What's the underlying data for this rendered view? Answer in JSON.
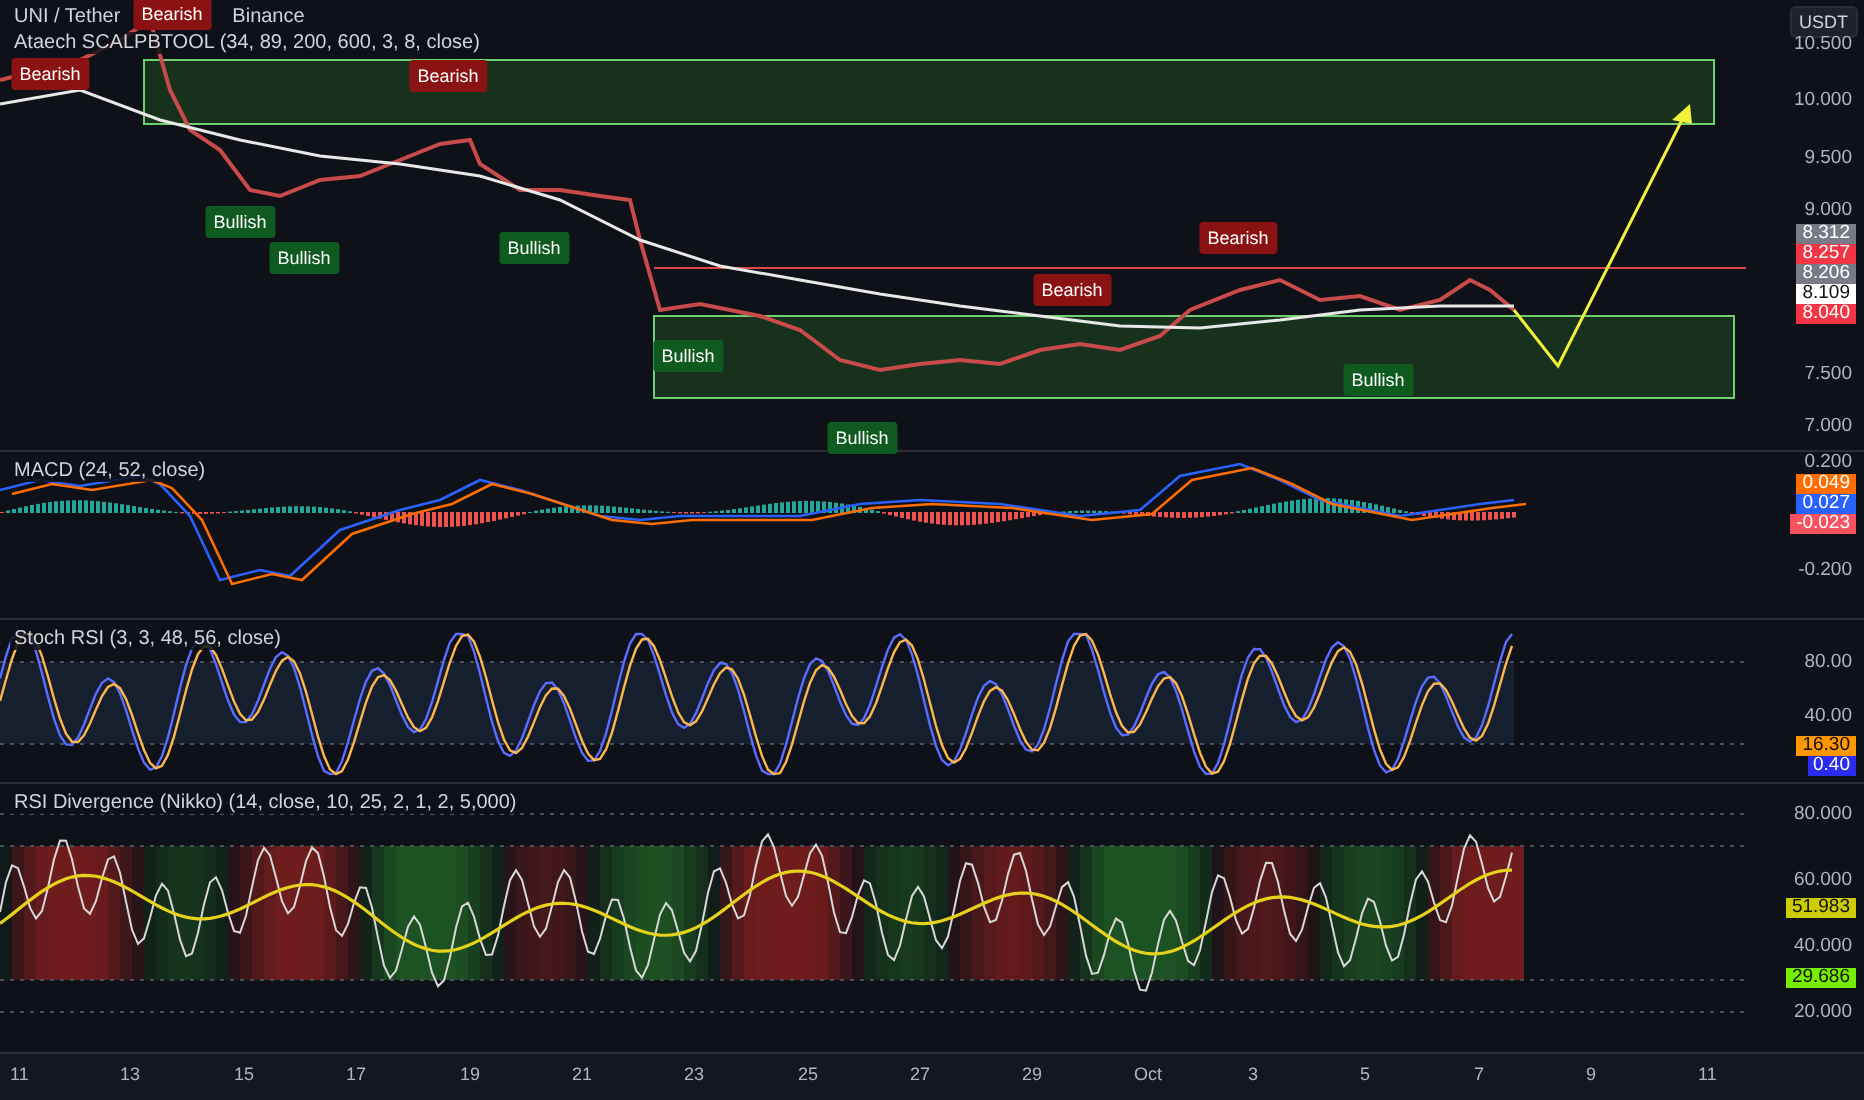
{
  "header": {
    "symbol": "UNI / Tether",
    "exchange": "Binance",
    "indicator": "Ataech SCALPBTOOL (34, 89, 200, 600, 3, 8, close)"
  },
  "currency_button": "USDT",
  "price_pane": {
    "axis_labels": [
      "10.500",
      "10.000",
      "9.500",
      "9.000",
      "7.500",
      "7.000"
    ],
    "price_tags": [
      {
        "text": "8.312",
        "color": "#787b86"
      },
      {
        "text": "8.257",
        "color": "#f23645"
      },
      {
        "text": "8.206",
        "color": "#787b86"
      },
      {
        "text": "8.109",
        "color": "#ffffff"
      },
      {
        "text": "8.040",
        "color": "#f23645"
      }
    ],
    "signals": [
      {
        "kind": "bearish",
        "text": "Bearish"
      },
      {
        "kind": "bearish",
        "text": "Bearish"
      },
      {
        "kind": "bearish",
        "text": "Bearish"
      },
      {
        "kind": "bullish",
        "text": "Bullish"
      },
      {
        "kind": "bullish",
        "text": "Bullish"
      },
      {
        "kind": "bullish",
        "text": "Bullish"
      },
      {
        "kind": "bullish",
        "text": "Bullish"
      },
      {
        "kind": "bullish",
        "text": "Bullish"
      },
      {
        "kind": "bearish",
        "text": "Bearish"
      },
      {
        "kind": "bearish",
        "text": "Bearish"
      },
      {
        "kind": "bullish",
        "text": "Bullish"
      }
    ]
  },
  "macd_pane": {
    "title": "MACD (24, 52, close)",
    "axis_labels": [
      "0.200",
      "-0.200"
    ],
    "value_tags": [
      {
        "text": "0.049",
        "color": "#ff6d00"
      },
      {
        "text": "0.027",
        "color": "#2962ff"
      },
      {
        "text": "-0.023",
        "color": "#f7525f"
      }
    ]
  },
  "stoch_pane": {
    "title": "Stoch RSI (3, 3, 48, 56, close)",
    "axis_labels": [
      "80.00",
      "40.00"
    ],
    "value_tags": [
      {
        "text": "16.30",
        "color": "#ff9800"
      },
      {
        "text": "0.40",
        "color": "#2b2bf0"
      }
    ]
  },
  "rsi_pane": {
    "title": "RSI Divergence (Nikko) (14, close, 10, 25, 2, 1, 2, 5,000)",
    "axis_labels": [
      "80.000",
      "60.000",
      "40.000",
      "20.000"
    ],
    "value_tags": [
      {
        "text": "51.983",
        "color": "#cccc00"
      },
      {
        "text": "29.686",
        "color": "#76ee00"
      }
    ]
  },
  "time_axis": [
    "11",
    "13",
    "15",
    "17",
    "19",
    "21",
    "23",
    "25",
    "27",
    "29",
    "Oct",
    "3",
    "5",
    "7",
    "9",
    "11"
  ]
}
